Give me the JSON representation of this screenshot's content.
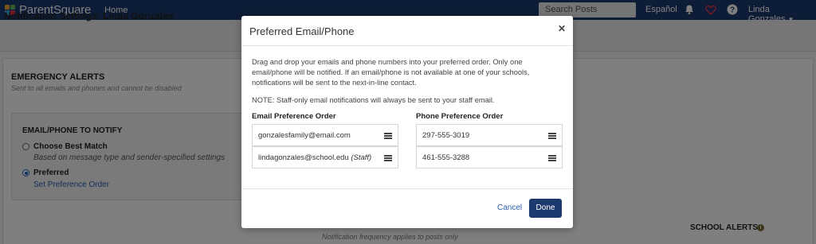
{
  "topnav": {
    "brand": "ParentSquare",
    "home": "Home",
    "search_placeholder": "Search Posts",
    "language": "Español",
    "user": "Linda Gonzales",
    "icons": [
      "bell-icon",
      "heart-icon",
      "help-icon"
    ],
    "colors": {
      "bar": "#1d3a6e",
      "heart": "#e0314b"
    }
  },
  "page": {
    "title": "Notification Settings: Linda Gonzales",
    "emergency": {
      "title": "EMERGENCY ALERTS",
      "subtitle": "Sent to all emails and phones and cannot be disabled"
    },
    "notify": {
      "title": "EMAIL/PHONE TO NOTIFY",
      "options": [
        {
          "label": "Choose Best Match",
          "sub": "Based on message type and sender-specified settings",
          "selected": false
        },
        {
          "label": "Preferred",
          "link": "Set Preference Order",
          "selected": true
        }
      ]
    },
    "frequency_caption": "Notification frequency applies to posts only",
    "school_alerts": "SCHOOL ALERTS"
  },
  "modal": {
    "title": "Preferred Email/Phone",
    "description": "Drag and drop your emails and phone numbers into your preferred order. Only one email/phone will be notified. If an email/phone is not available at one of your schools, notifications will be sent to the next-in-line contact.",
    "note": "NOTE: Staff-only email notifications will always be sent to your staff email.",
    "email_column_title": "Email Preference Order",
    "phone_column_title": "Phone Preference Order",
    "emails": [
      {
        "address": "gonzalesfamily@email.com",
        "tag": ""
      },
      {
        "address": "lindagonzales@school.edu",
        "tag": "(Staff)"
      }
    ],
    "phones": [
      "297-555-3019",
      "461-555-3288"
    ],
    "cancel_label": "Cancel",
    "done_label": "Done"
  }
}
